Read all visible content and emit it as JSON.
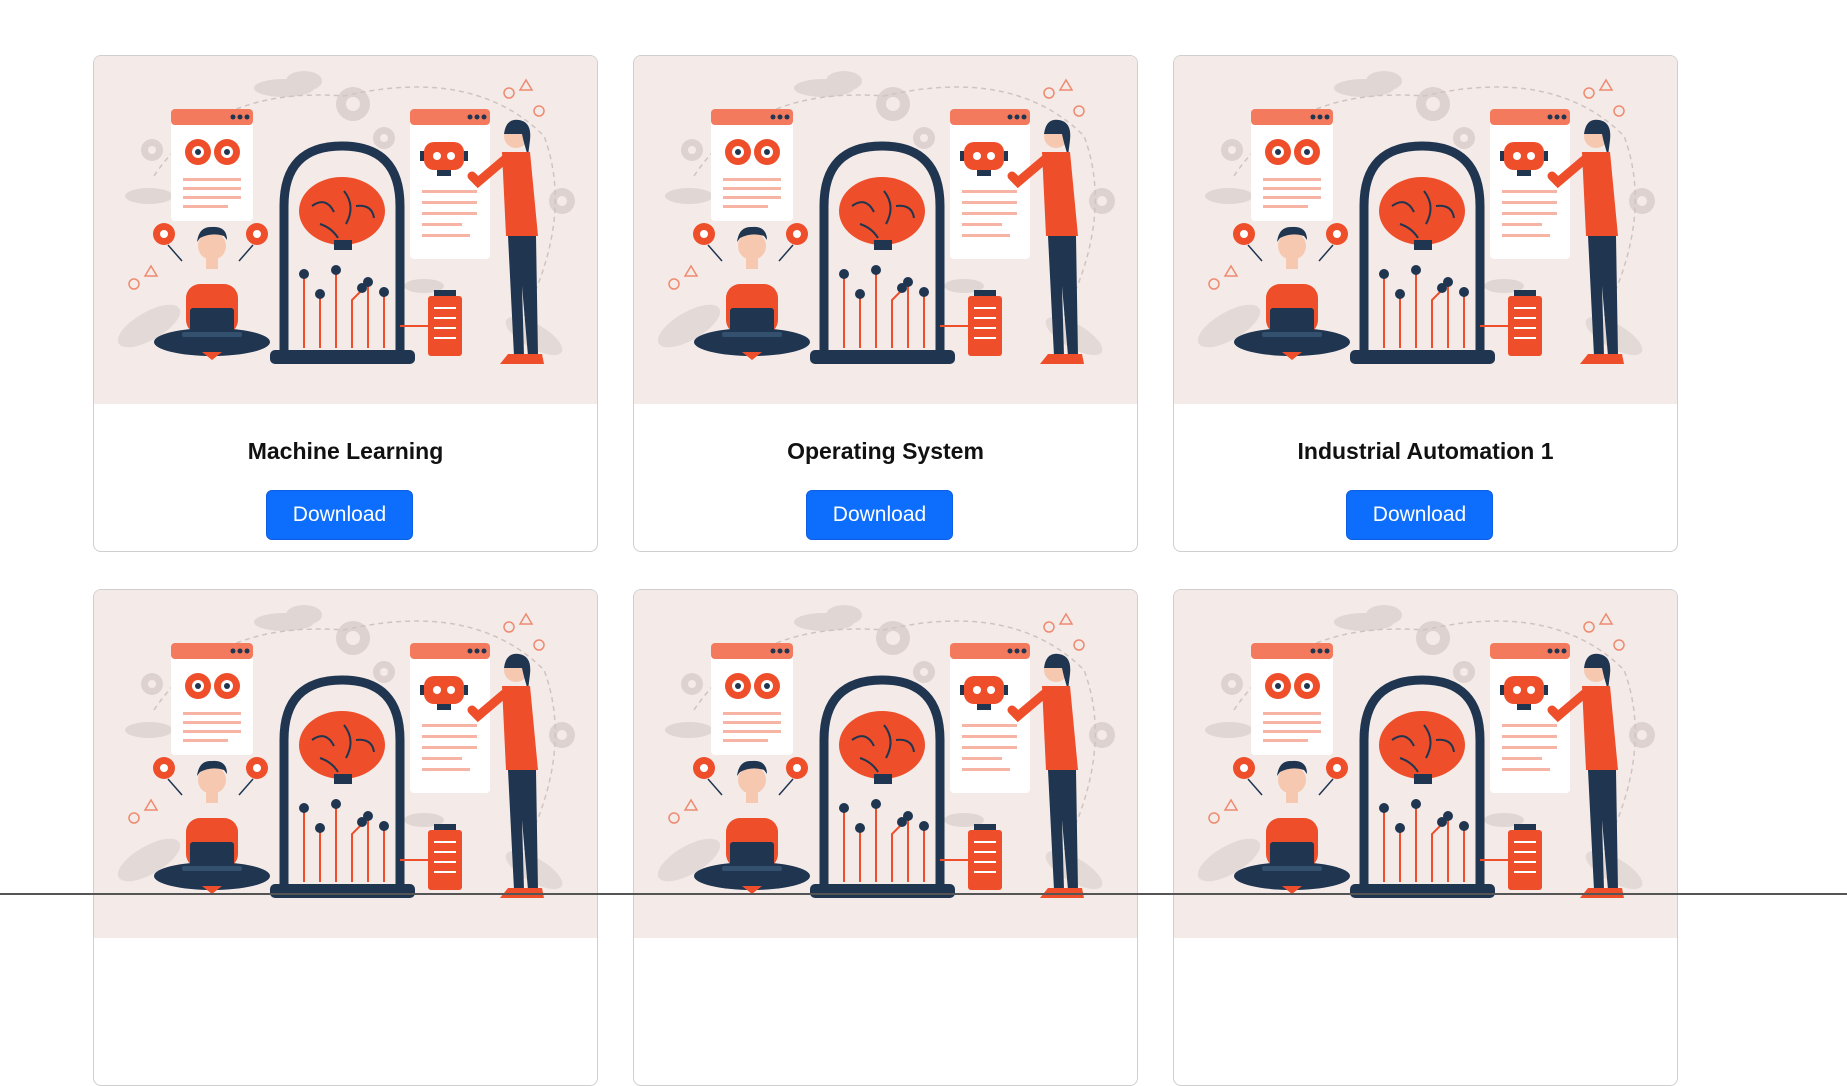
{
  "cards": [
    {
      "title": "Machine Learning",
      "button": "Download",
      "image": "ai-illustration"
    },
    {
      "title": "Operating System",
      "button": "Download",
      "image": "ai-illustration"
    },
    {
      "title": "Industrial Automation 1",
      "button": "Download",
      "image": "ai-illustration"
    },
    {
      "title": "",
      "button": "",
      "image": "ai-illustration"
    },
    {
      "title": "",
      "button": "",
      "image": "ai-illustration"
    },
    {
      "title": "",
      "button": "",
      "image": "ai-illustration"
    }
  ],
  "colors": {
    "accent": "#ee4e2a",
    "navy": "#1f3550",
    "button": "#0d6efd",
    "image_bg": "#f4ebe8"
  }
}
